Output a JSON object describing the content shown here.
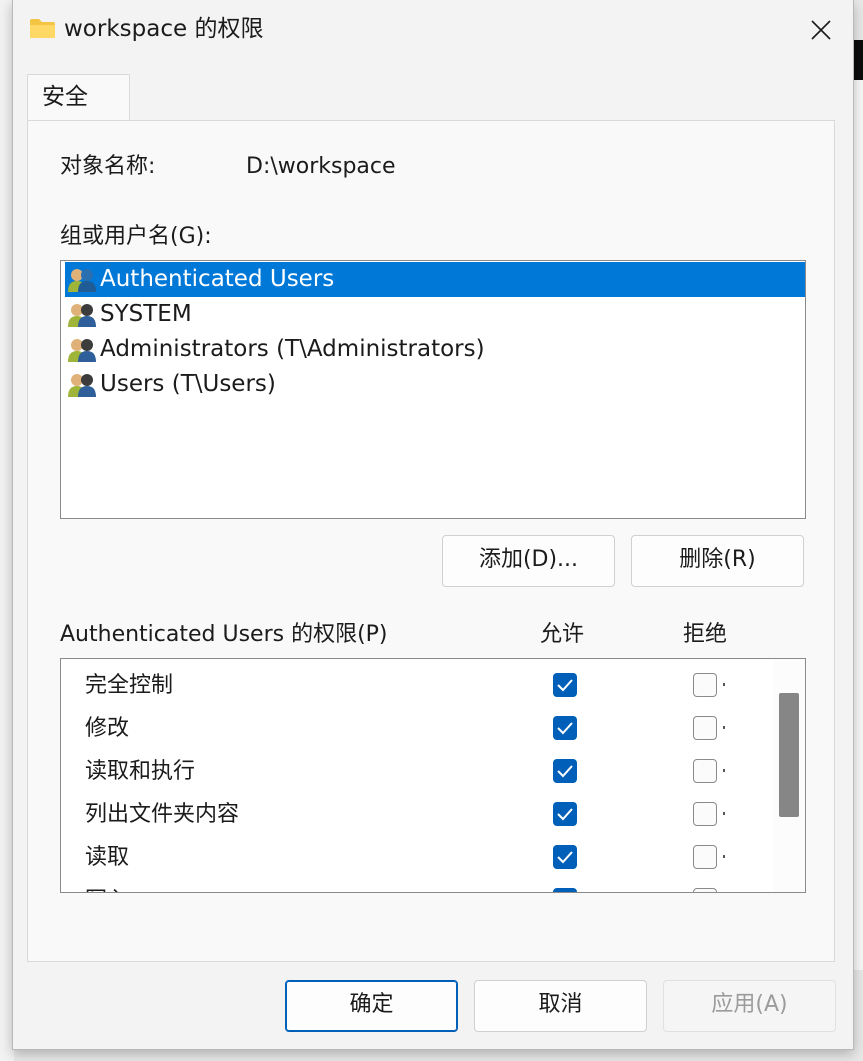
{
  "window": {
    "title": "workspace 的权限",
    "close_icon": "close-icon",
    "folder_icon": "folder-icon"
  },
  "tabs": [
    {
      "label": "安全"
    }
  ],
  "object": {
    "label": "对象名称:",
    "value": "D:\\workspace"
  },
  "groups": {
    "label": "组或用户名(G):",
    "items": [
      {
        "name": "Authenticated Users",
        "selected": true
      },
      {
        "name": "SYSTEM",
        "selected": false
      },
      {
        "name": "Administrators (T\\Administrators)",
        "selected": false
      },
      {
        "name": "Users (T\\Users)",
        "selected": false
      }
    ]
  },
  "buttons": {
    "add": "添加(D)...",
    "remove": "删除(R)",
    "ok": "确定",
    "cancel": "取消",
    "apply": "应用(A)"
  },
  "permissions": {
    "label": "Authenticated Users 的权限(P)",
    "allow_header": "允许",
    "deny_header": "拒绝",
    "rows": [
      {
        "name": "完全控制",
        "allow": true,
        "deny": false
      },
      {
        "name": "修改",
        "allow": true,
        "deny": false
      },
      {
        "name": "读取和执行",
        "allow": true,
        "deny": false
      },
      {
        "name": "列出文件夹内容",
        "allow": true,
        "deny": false
      },
      {
        "name": "读取",
        "allow": true,
        "deny": false
      },
      {
        "name": "写入",
        "allow": true,
        "deny": false
      }
    ]
  },
  "colors": {
    "accent": "#005fb8",
    "selection": "#0078d7"
  }
}
